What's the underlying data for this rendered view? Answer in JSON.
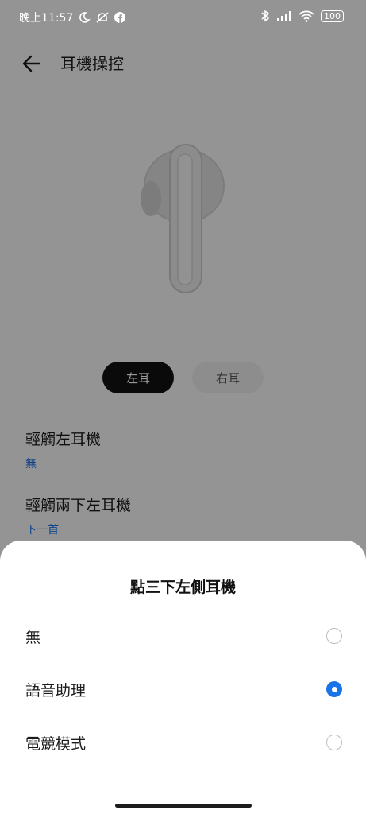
{
  "status_bar": {
    "time": "晚上11:57",
    "battery": "100",
    "icons": [
      "moon-icon",
      "mute-icon",
      "facebook-icon",
      "bluetooth-icon",
      "signal-icon",
      "wifi-icon",
      "battery-icon"
    ]
  },
  "header": {
    "title": "耳機操控"
  },
  "tabs": [
    {
      "label": "左耳",
      "selected": true
    },
    {
      "label": "右耳",
      "selected": false
    }
  ],
  "settings": [
    {
      "label": "輕觸左耳機",
      "value": "無"
    },
    {
      "label": "輕觸兩下左耳機",
      "value": "下一首"
    }
  ],
  "sheet": {
    "title": "點三下左側耳機",
    "options": [
      {
        "label": "無",
        "selected": false
      },
      {
        "label": "語音助理",
        "selected": true
      },
      {
        "label": "電競模式",
        "selected": false
      }
    ]
  },
  "colors": {
    "accent": "#1a73e8",
    "selected_tab": "#111111",
    "overlay": "rgba(0,0,0,0.40)"
  }
}
